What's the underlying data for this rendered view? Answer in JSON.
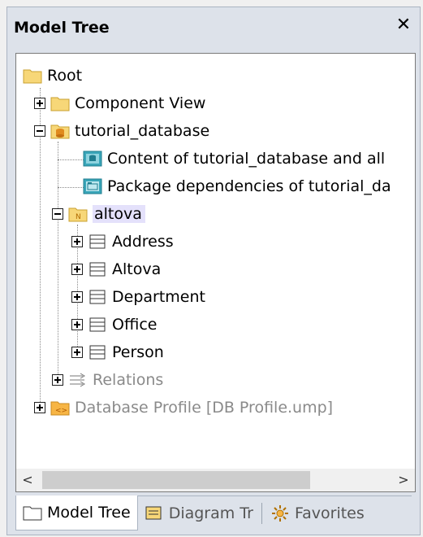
{
  "panel": {
    "title": "Model Tree",
    "close_label": "✕"
  },
  "tree": {
    "root": "Root",
    "component_view": "Component View",
    "tutorial_database": "tutorial_database",
    "content_diagram": "Content of tutorial_database and all",
    "package_dependencies": "Package dependencies of tutorial_da",
    "altova": "altova",
    "tables": [
      "Address",
      "Altova",
      "Department",
      "Office",
      "Person"
    ],
    "relations": "Relations",
    "database_profile": "Database Profile [DB Profile.ump]"
  },
  "scrollbar": {
    "left_arrow": "<",
    "right_arrow": ">"
  },
  "tabs": [
    {
      "label": "Model Tree",
      "icon": "folder-icon",
      "active": true
    },
    {
      "label": "Diagram Tr",
      "icon": "diagram-tree-icon",
      "active": false
    },
    {
      "label": "Favorites",
      "icon": "favorites-icon",
      "active": false
    }
  ],
  "colors": {
    "selection": "#e4e1fb",
    "folder": "#f7d778",
    "diagram_teal": "#3aa6b9"
  }
}
